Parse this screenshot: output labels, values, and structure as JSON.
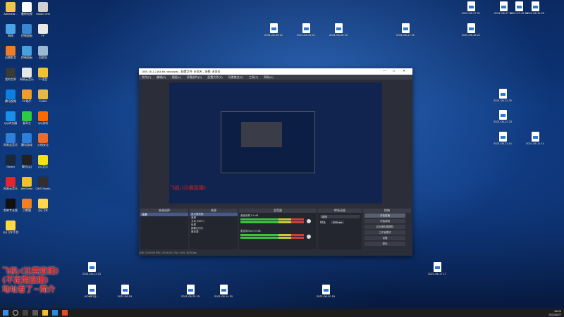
{
  "desktop_left_icons": [
    {
      "label": "Administr...",
      "color": "#f3c34a"
    },
    {
      "label": "最新电视",
      "color": "#ffffff"
    },
    {
      "label": "Studio One",
      "color": "#d0d0d0"
    },
    {
      "label": "网络",
      "color": "#4aa3e8"
    },
    {
      "label": "控制面板",
      "color": "#3a86d0"
    },
    {
      "label": "FF",
      "color": "#e8e8e8"
    },
    {
      "label": "迅雷影音",
      "color": "#f07c28"
    },
    {
      "label": "控制面板",
      "color": "#45a0e0"
    },
    {
      "label": "回收站",
      "color": "#9ab7d3"
    },
    {
      "label": "我的世界",
      "color": "#3a3a3a"
    },
    {
      "label": "网易云音乐",
      "color": "#e7e7e7"
    },
    {
      "label": "YY语音",
      "color": "#f1c232"
    },
    {
      "label": "腾讯视频",
      "color": "#0c7fe3"
    },
    {
      "label": "PP助手",
      "color": "#ef9c2c"
    },
    {
      "label": "PUBG",
      "color": "#e6b84a"
    },
    {
      "label": "QQ浏览器",
      "color": "#1a8fe8"
    },
    {
      "label": "爱奇艺",
      "color": "#2ecc40"
    },
    {
      "label": "QQ游戏",
      "color": "#ff6a00"
    },
    {
      "label": "网易云音乐",
      "color": "#2e7fd9"
    },
    {
      "label": "腾讯游戏",
      "color": "#2e7fd9"
    },
    {
      "label": "火绒安全",
      "color": "#f06a2a"
    },
    {
      "label": "Steam",
      "color": "#1b2838"
    },
    {
      "label": "腾讯QQ",
      "color": "#222222"
    },
    {
      "label": "QQ音乐",
      "color": "#f2e11a"
    },
    {
      "label": "网易云音乐",
      "color": "#e0262f"
    },
    {
      "label": "WeGame",
      "color": "#f0c030"
    },
    {
      "label": "OBS Studio",
      "color": "#302e31"
    },
    {
      "label": "剪映专业版",
      "color": "#111111"
    },
    {
      "label": "小熊猫",
      "color": "#f08020"
    },
    {
      "label": "QQ飞车",
      "color": "#ffd84a"
    },
    {
      "label": "QQ飞车手游",
      "color": "#ffd84a"
    }
  ],
  "desktop_right_docs": [
    {
      "label": "2021-06-17 21-10-..."
    },
    {
      "label": "2021-06-17 20-52-52"
    },
    {
      "label": "2021-07-15 14-23-36"
    },
    {
      "label": "2021-06-15 20-53-1..."
    },
    {
      "label": "2021-06-15 21-12-51"
    },
    {
      "label": "2021-06-15 21-47-00"
    },
    {
      "label": "2021-06-16 23-19-48"
    },
    {
      "label": "2021-06-17 21-16-48..."
    },
    {
      "label": "2021-06-15 21-16-51"
    },
    {
      "label": "2021-06-13 20-33-07"
    },
    {
      "label": "2021-06-12 23-59-04"
    },
    {
      "label": "2021-06-11 14-07-..."
    },
    {
      "label": "2021-06-11 14-55-22"
    }
  ],
  "obs": {
    "title": "OBS 26.1.2 (64-bit, windows) - 配置文件: 未命名 - 场景: 未命名",
    "menu": [
      "文件(F)",
      "编辑(E)",
      "视图(V)",
      "停靠部件(D)",
      "配置文件(P)",
      "场景集合(S)",
      "工具(T)",
      "帮助(H)"
    ],
    "preview_caption": "飞机:(比赛直播)",
    "dock_headers": {
      "scenes": "来源选择",
      "sources": "来源",
      "mixer": "混音器",
      "transitions": "转场动画",
      "controls": "控制"
    },
    "scene_item": "场景",
    "sources": [
      "显示器采集",
      "音频",
      "文本 (GDI+)",
      "色源",
      "图像幻灯片",
      "媒体源"
    ],
    "mixer_tracks": [
      {
        "name": "桌面音频",
        "db": "0.0 dB"
      },
      {
        "name": "麦克风/Aux",
        "db": "0.0 dB"
      }
    ],
    "transition": {
      "type": "淡出",
      "duration_label": "时长",
      "duration_value": "300 ms"
    },
    "controls": [
      "开始直播",
      "开始录制",
      "启动虚拟摄像机",
      "工作室模式",
      "设置",
      "退出"
    ],
    "status": "LIVE: 00:00:00   REC: 00:00:00   CPU: 4.6%, 30.00 fps"
  },
  "overlay_text": [
    "飞机:(比赛直播)",
    "(不定期直播)",
    "地址看了~简介"
  ],
  "bottom_desktop_labels": [
    {
      "label": "2021-06-11 13-..."
    },
    {
      "label": "AOMEI分..."
    },
    {
      "label": "2021-06-15"
    },
    {
      "label": "2021-06-20 15-53-..."
    },
    {
      "label": "2021-06-14 20-59-..."
    },
    {
      "label": "2021-06-10 15-33-..."
    },
    {
      "label": "2021-06-17 17-45-..."
    }
  ],
  "taskbar": {
    "time": "18:20",
    "date": "2021/6/27"
  }
}
